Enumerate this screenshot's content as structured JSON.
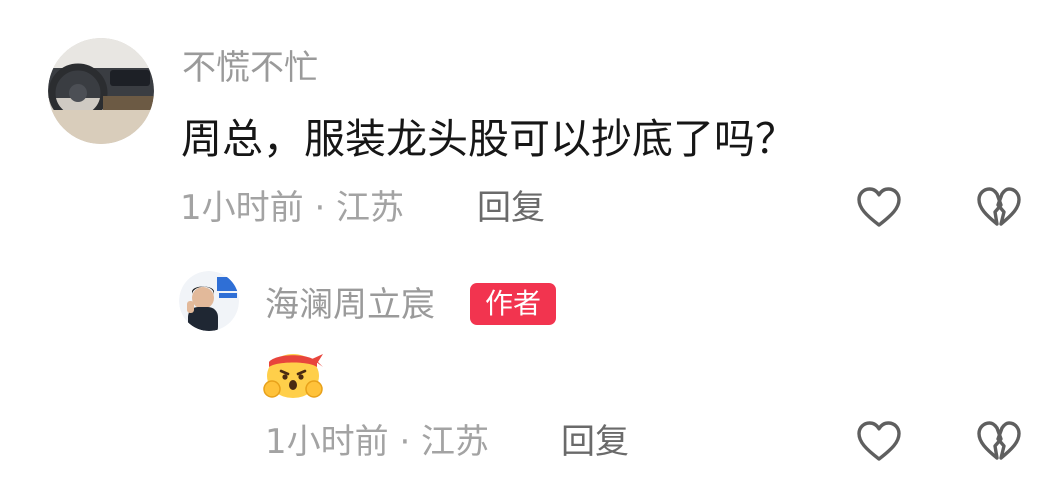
{
  "comment": {
    "username": "不慌不忙",
    "text": "周总，服装龙头股可以抄底了吗？",
    "meta": "1小时前 · 江苏",
    "reply_label": "回复",
    "like_icon": "heart-outline-icon",
    "dislike_icon": "broken-heart-icon"
  },
  "reply": {
    "username": "海澜周立宸",
    "badge": "作者",
    "emoji": "angry-headband-emoji",
    "meta": "1小时前 · 江苏",
    "reply_label": "回复",
    "like_icon": "heart-outline-icon",
    "dislike_icon": "broken-heart-icon"
  },
  "colors": {
    "badge_bg": "#f2344f",
    "username": "#9a9a9a",
    "text": "#161616",
    "meta": "#a3a3a3",
    "reply_label": "#6a6a6a"
  }
}
